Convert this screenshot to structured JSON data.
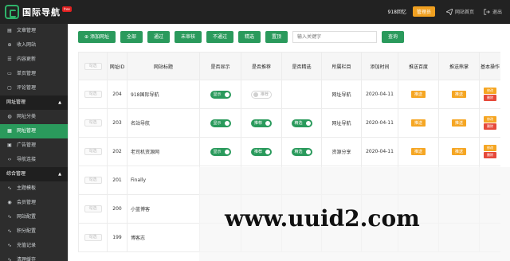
{
  "header": {
    "logo_text": "国际导航",
    "logo_badge": "free",
    "user": "918回忆",
    "role": "管理员",
    "home": "网站首页",
    "logout": "退出"
  },
  "sidebar": {
    "items": [
      {
        "label": "文章管理",
        "icon": "doc-icon"
      },
      {
        "label": "收入网站",
        "icon": "plus-icon"
      },
      {
        "label": "内容更新",
        "icon": "list-icon"
      },
      {
        "label": "单页管理",
        "icon": "page-icon"
      },
      {
        "label": "评论管理",
        "icon": "comment-icon"
      }
    ],
    "group1": "网址管理",
    "group1_items": [
      {
        "label": "网址分类",
        "icon": "globe-icon"
      },
      {
        "label": "网址管理",
        "icon": "grid-icon",
        "active": true
      },
      {
        "label": "广告管理",
        "icon": "ad-icon"
      },
      {
        "label": "导航连接",
        "icon": "code-icon"
      }
    ],
    "group2": "综合管理",
    "group2_items": [
      {
        "label": "主题模板",
        "icon": "pulse-icon"
      },
      {
        "label": "会员管理",
        "icon": "user-icon"
      },
      {
        "label": "网站配置",
        "icon": "pulse-icon"
      },
      {
        "label": "积分配置",
        "icon": "pulse-icon"
      },
      {
        "label": "充值记录",
        "icon": "pulse-icon"
      },
      {
        "label": "清理缓存",
        "icon": "pulse-icon"
      }
    ]
  },
  "toolbar": {
    "add": "添加网址",
    "all": "全部",
    "pass": "通过",
    "pending": "未审核",
    "reject": "不通过",
    "featured": "精选",
    "top": "置顶",
    "search_placeholder": "输入关键字",
    "query": "查询"
  },
  "table": {
    "headers": [
      "勾选",
      "网址ID",
      "网站标题",
      "是否显示",
      "是否推荐",
      "是否精选",
      "所属栏目",
      "添加时间",
      "推送百度",
      "推送熊掌",
      "基本操作"
    ],
    "rows": [
      {
        "check": "勾选",
        "id": "204",
        "title": "918国际导航",
        "show": "显示",
        "recommend": "推荐",
        "featured": "",
        "column": "网址导航",
        "date": "2020-04-11",
        "baidu": "推送",
        "bear": "推送",
        "edit": "修改",
        "del": "删除"
      },
      {
        "check": "勾选",
        "id": "203",
        "title": "名站导航",
        "show": "显示",
        "recommend": "推荐",
        "featured": "精选",
        "column": "网址导航",
        "date": "2020-04-11",
        "baidu": "推送",
        "bear": "推送",
        "edit": "修改",
        "del": "删除"
      },
      {
        "check": "勾选",
        "id": "202",
        "title": "老司机资源网",
        "show": "显示",
        "recommend": "推荐",
        "featured": "精选",
        "column": "资源分享",
        "date": "2020-04-11",
        "baidu": "推送",
        "bear": "推送",
        "edit": "修改",
        "del": "删除"
      },
      {
        "check": "勾选",
        "id": "201",
        "title": "Finally"
      },
      {
        "check": "勾选",
        "id": "200",
        "title": "小蓝博客"
      },
      {
        "check": "勾选",
        "id": "199",
        "title": "博客志"
      }
    ]
  },
  "watermark": "www.uuid2.com"
}
